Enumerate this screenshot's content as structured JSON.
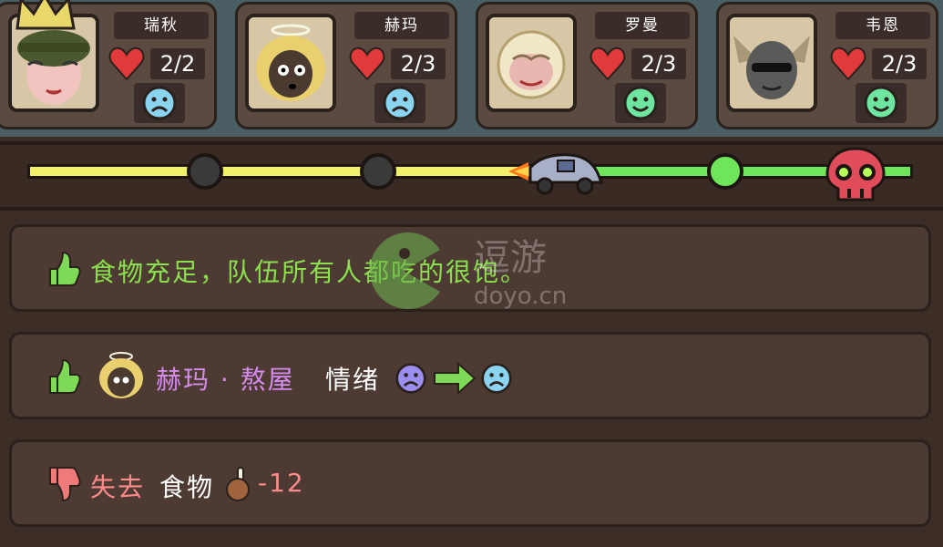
{
  "party": [
    {
      "name": "瑞秋",
      "hp": "2/2",
      "mood": "sad"
    },
    {
      "name": "赫玛",
      "hp": "2/3",
      "mood": "sad"
    },
    {
      "name": "罗曼",
      "hp": "2/3",
      "mood": "happy"
    },
    {
      "name": "韦恩",
      "hp": "2/3",
      "mood": "happy"
    }
  ],
  "progress": {
    "traveled_fraction": 0.58,
    "nodes": [
      "passed",
      "passed",
      "upcoming"
    ],
    "end_marker": "skull-icon"
  },
  "events": {
    "food_message": "食物充足，队伍所有人都吃的很饱。",
    "mood_name": "赫玛 · 熬屋",
    "mood_label": "情绪",
    "loss_label": "失去",
    "loss_item": "食物",
    "loss_amount": "-12"
  },
  "watermark": {
    "brand": "逗游",
    "url": "doyo.cn"
  },
  "colors": {
    "good_text": "#8be04e",
    "name_text": "#d68cf0",
    "bad_text": "#ff8a8a",
    "track_yellow": "#f2f06a",
    "track_green": "#6ee65a",
    "sad_face": "#8ad4f0",
    "happy_face": "#6ee6a0",
    "heart": "#e03a3a"
  }
}
